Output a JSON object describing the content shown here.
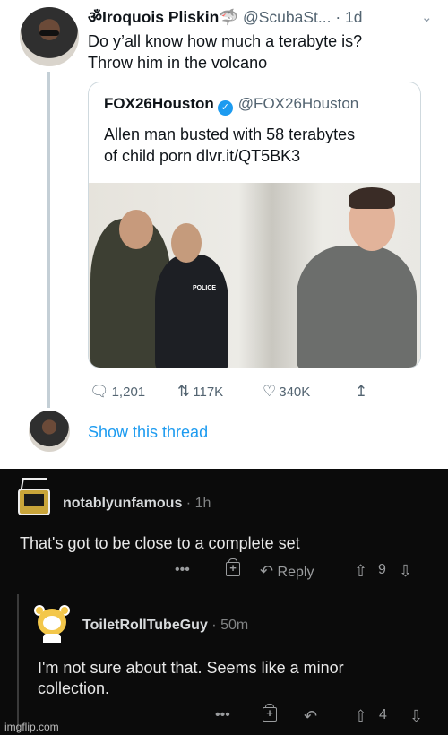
{
  "tweet": {
    "display_name": "ॐIroquois Pliskin",
    "name_emoji": "🦈",
    "handle": "@ScubaSt...",
    "time": "· 1d",
    "text_line1": "Do y’all know how much a terabyte is?",
    "text_line2": "Throw him in the volcano",
    "quote": {
      "name": "FOX26Houston",
      "verified_glyph": "✓",
      "handle": "@FOX26Houston",
      "text_line1": "Allen man busted with 58 terabytes",
      "text_line2": "of child porn dlvr.it/QT5BK3",
      "image_label": "POLICE"
    },
    "actions": {
      "replies": "1,201",
      "retweets": "117K",
      "likes": "340K"
    },
    "show_thread": "Show this thread"
  },
  "reddit": {
    "comment1": {
      "user": "notablyunfamous",
      "time": "· 1h",
      "text": "That's got to be close to a complete set",
      "more": "•••",
      "reply_label": "Reply",
      "score": "9"
    },
    "comment2": {
      "user": "ToiletRollTubeGuy",
      "time": "· 50m",
      "text_line1": "I'm not sure about that. Seems like a minor",
      "text_line2": "collection.",
      "more": "•••",
      "score": "4"
    }
  },
  "watermark": "imgflip.com",
  "colors": {
    "twitter_blue": "#1d9bf0",
    "reddit_bg": "#0b0b0b"
  }
}
